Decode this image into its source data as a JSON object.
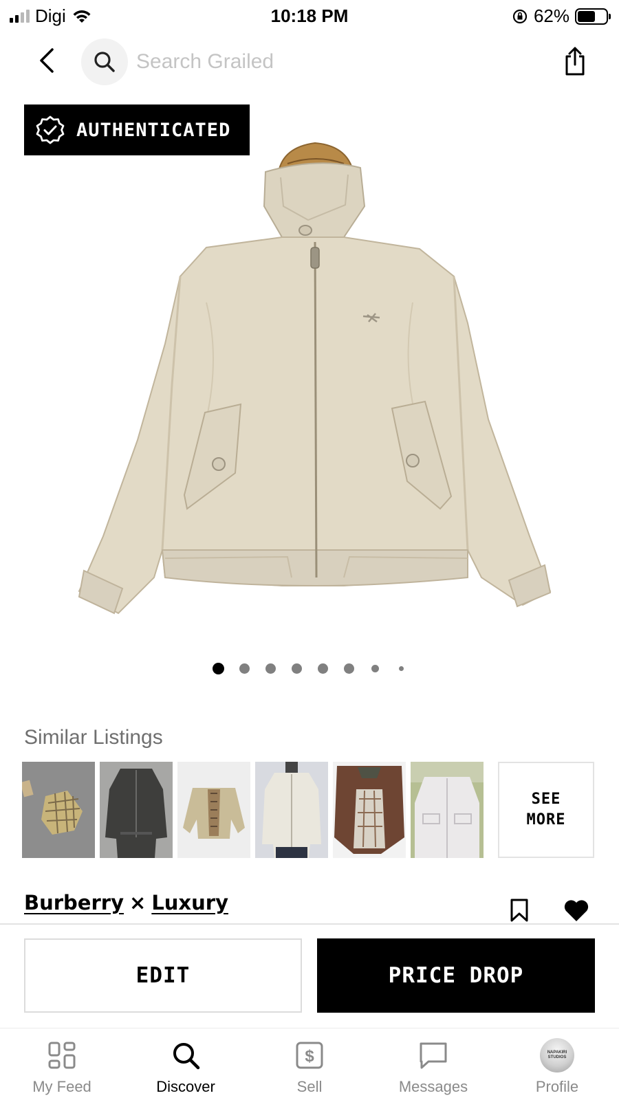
{
  "status_bar": {
    "carrier": "Digi",
    "time": "10:18 PM",
    "battery": "62%",
    "battery_level": 0.62
  },
  "topnav": {
    "search_placeholder": "Search Grailed",
    "icons": [
      "back-arrow-icon",
      "search-icon",
      "share-icon"
    ]
  },
  "product": {
    "badge": "AUTHENTICATED",
    "image_count": 8,
    "active_image": 0
  },
  "similar": {
    "title": "Similar Listings",
    "thumbnails": [
      {
        "name": "plaid-shirt",
        "bg": "#8f8f8f"
      },
      {
        "name": "dark-jacket-model",
        "bg": "#9a9a98"
      },
      {
        "name": "tan-harrington-nova",
        "bg": "#efefef"
      },
      {
        "name": "cream-jacket-model",
        "bg": "#d9dbe2"
      },
      {
        "name": "brown-jacket",
        "bg": "#f3f3f3"
      },
      {
        "name": "white-jacket",
        "bg": "#b8c093"
      }
    ],
    "see_more_line1": "SEE",
    "see_more_line2": "MORE"
  },
  "brands": {
    "brand1": "Burberry",
    "separator": "×",
    "brand2": "Luxury"
  },
  "actions": {
    "edit": "EDIT",
    "price_drop": "PRICE DROP"
  },
  "tabs": [
    {
      "label": "My Feed",
      "icon": "feed-grid-icon"
    },
    {
      "label": "Discover",
      "icon": "search-icon"
    },
    {
      "label": "Sell",
      "icon": "dollar-tag-icon"
    },
    {
      "label": "Messages",
      "icon": "chat-bubble-icon"
    },
    {
      "label": "Profile",
      "icon": "avatar"
    }
  ],
  "profile_avatar_text": "NAPAKIRI STUDIOS"
}
